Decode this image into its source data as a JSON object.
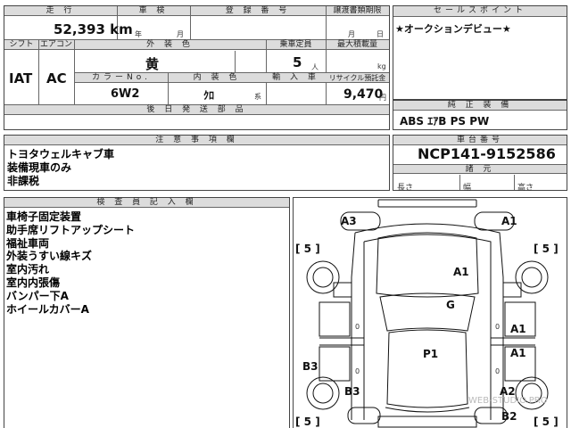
{
  "top_table": {
    "mileage_label": "走 行",
    "mileage_value": "52,393 km",
    "inspection_label": "車 検",
    "inspection_year_unit": "年",
    "inspection_month_unit": "月",
    "registration_label": "登 録 番 号",
    "transfer_deadline_label": "譲渡書類期限",
    "transfer_month_unit": "月",
    "transfer_day_unit": "日",
    "shift_label": "シフト",
    "shift_value": "IAT",
    "ac_label": "エアコン",
    "ac_value": "AC",
    "exterior_color_label": "外 装 色",
    "exterior_color_value": "黄",
    "capacity_label": "乗車定員",
    "capacity_value": "5",
    "capacity_unit": "人",
    "max_load_label": "最大積載量",
    "max_load_unit": "kg",
    "color_no_label": "カラーNo.",
    "color_no_value": "6W2",
    "interior_color_label": "内 装 色",
    "interior_color_value": "ｸﾛ",
    "interior_color_unit": "系",
    "import_label": "輸 入 車",
    "recycle_label": "リサイクル預託金",
    "recycle_value": "9,470",
    "recycle_unit": "円",
    "retrofit_label": "後 日 発 送 部 品"
  },
  "sales_point": {
    "label": "セールスポイント",
    "text": "★オークションデビュー★"
  },
  "equipment": {
    "label": "純 正 装 備",
    "text": "ABS ｴｱB PS PW"
  },
  "notes": {
    "label": "注 意 事 項 欄",
    "lines": [
      "トヨタウェルキャブ車",
      "装備現車のみ",
      "非課税"
    ]
  },
  "chassis": {
    "label": "車台番号",
    "value": "NCP141-9152586",
    "spec_label": "諸 元",
    "length_label": "長さ",
    "width_label": "幅",
    "height_label": "高さ"
  },
  "inspector": {
    "label": "検 査 員 記 入 欄",
    "lines": [
      "車椅子固定装置",
      "助手席リフトアップシート",
      "福祉車両",
      "外装うすい線キズ",
      "室内汚れ",
      "室内内張傷",
      "バンパー下A",
      "ホイールカバーA"
    ]
  },
  "diagram": {
    "labels": {
      "a3": "A3",
      "a1_top_right": "A1",
      "a1_hood": "A1",
      "g": "G",
      "a1_right_upper": "A1",
      "a1_right_lower": "A1",
      "p1": "P1",
      "b3_left": "B3",
      "b3_bottom": "B3",
      "a2": "A2",
      "b2": "B2"
    },
    "brackets": {
      "left_upper": "[ 5 ]",
      "right_upper": "[ 5 ]",
      "left_lower": "[ 5 ]",
      "right_lower": "[ 5 ]"
    },
    "zero": "0"
  },
  "watermark": "WEB-STUDIO.PRO"
}
